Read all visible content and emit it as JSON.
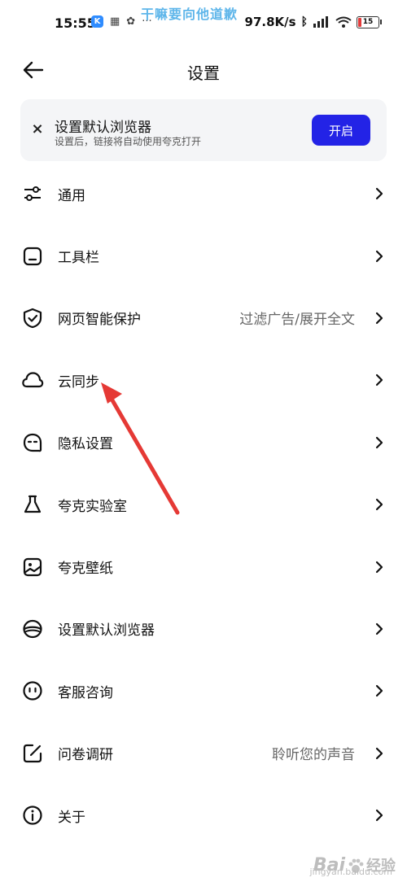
{
  "status_bar": {
    "time": "15:55",
    "app_badge": "K",
    "more": "···",
    "watermark": "干嘛要向他道歉",
    "speed": "97.8K/s",
    "battery": "15"
  },
  "header": {
    "title": "设置"
  },
  "banner": {
    "title": "设置默认浏览器",
    "subtitle": "设置后，链接将自动使用夸克打开",
    "button": "开启"
  },
  "items": [
    {
      "label": "通用",
      "value": "",
      "icon": "sliders-icon"
    },
    {
      "label": "工具栏",
      "value": "",
      "icon": "toolbar-icon"
    },
    {
      "label": "网页智能保护",
      "value": "过滤广告/展开全文",
      "icon": "shield-check-icon"
    },
    {
      "label": "云同步",
      "value": "",
      "icon": "cloud-icon"
    },
    {
      "label": "隐私设置",
      "value": "",
      "icon": "privacy-face-icon"
    },
    {
      "label": "夸克实验室",
      "value": "",
      "icon": "flask-icon"
    },
    {
      "label": "夸克壁纸",
      "value": "",
      "icon": "wallpaper-icon"
    },
    {
      "label": "设置默认浏览器",
      "value": "",
      "icon": "browser-icon"
    },
    {
      "label": "客服咨询",
      "value": "",
      "icon": "support-face-icon"
    },
    {
      "label": "问卷调研",
      "value": "聆听您的声音",
      "icon": "edit-icon"
    },
    {
      "label": "关于",
      "value": "",
      "icon": "info-icon"
    }
  ],
  "watermark": {
    "brand": "Bai",
    "sub": "经验",
    "url": "jingyan.baidu.com"
  },
  "colors": {
    "accent": "#2323e6",
    "annotation": "#e53935"
  }
}
